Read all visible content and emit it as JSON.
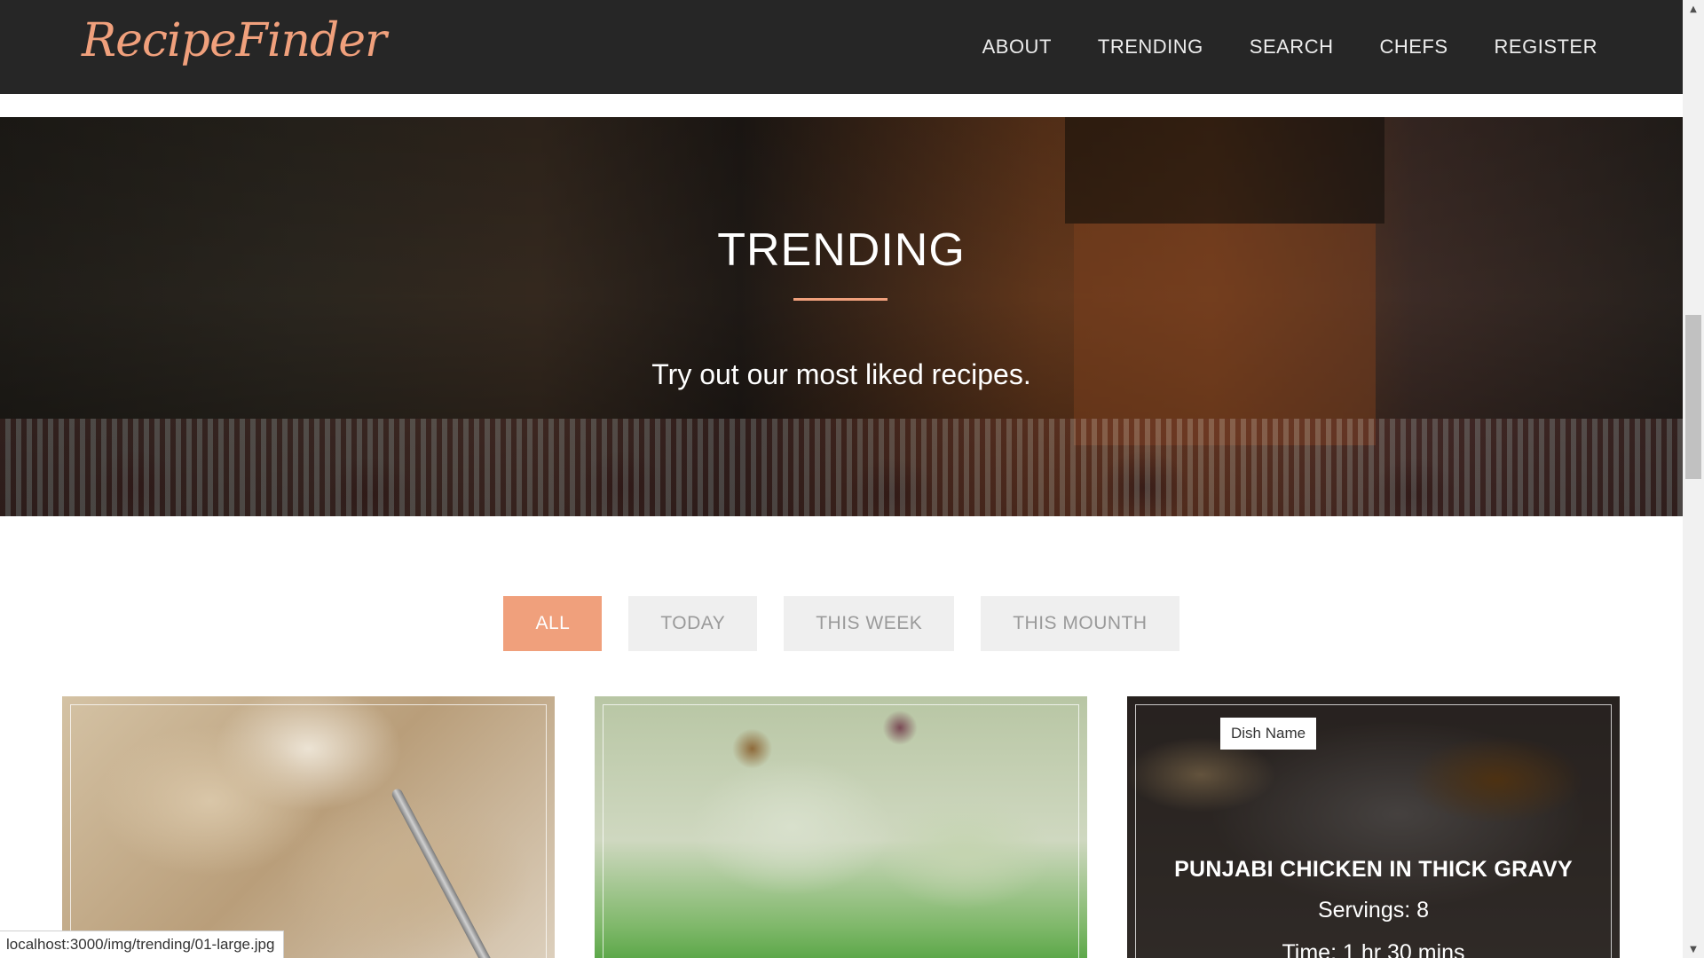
{
  "navbar": {
    "logo": "RecipeFinder",
    "links": [
      "ABOUT",
      "TRENDING",
      "SEARCH",
      "CHEFS",
      "REGISTER"
    ]
  },
  "hero": {
    "title": "TRENDING",
    "subtitle": "Try out our most liked recipes."
  },
  "filters": {
    "items": [
      "ALL",
      "TODAY",
      "THIS WEEK",
      "THIS MOUNTH"
    ],
    "active": "ALL"
  },
  "cards": [
    {
      "image": "rice dish with fork"
    },
    {
      "image": "chicken salad with grapes"
    },
    {
      "image": "chicken curry with naan",
      "tag": "Dish Name",
      "title": "PUNJABI CHICKEN IN THICK GRAVY",
      "servings": "Servings: 8",
      "time": "Time: 1 hr 30 mins"
    }
  ],
  "status_bar": {
    "url": "localhost:3000/img/trending/01-large.jpg"
  },
  "colors": {
    "accent": "#f0a07c",
    "navbar_bg": "#262626",
    "filter_bg": "#efefef"
  }
}
